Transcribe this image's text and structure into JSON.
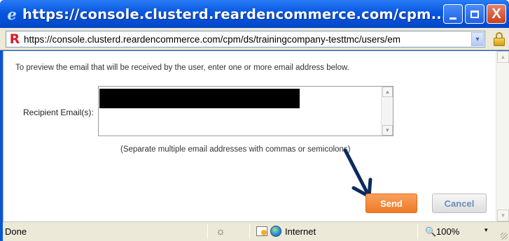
{
  "window": {
    "title": "https://console.clusterd.reardencommerce.com/cpm...",
    "minimize_icon": "minimize-icon",
    "maximize_icon": "maximize-icon",
    "close_label": "X"
  },
  "address": {
    "url": "https://console.clusterd.reardencommerce.com/cpm/ds/trainingcompany-testtmc/users/em",
    "site_logo": "R",
    "dropdown": "▾"
  },
  "form": {
    "instruction": "To preview the email that will be received by the user, enter one or more email address below.",
    "recipient_label": "Recipient Email(s):",
    "helper": "(Separate multiple email addresses with commas or semicolons)",
    "send_label": "Send",
    "cancel_label": "Cancel"
  },
  "status": {
    "text": "Done",
    "zone": "Internet",
    "zoom": "100%",
    "zoom_dropdown": "▾"
  },
  "colors": {
    "titlebar": "#0857e0",
    "send": "#ef7a26",
    "cancel_text": "#6a8fb8",
    "annotation_arrow": "#0d2a5c"
  }
}
